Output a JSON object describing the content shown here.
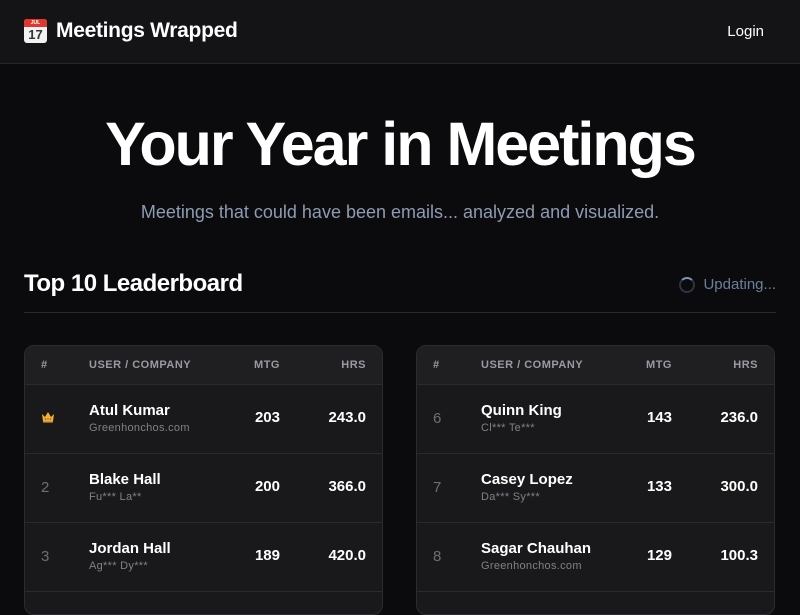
{
  "header": {
    "calendar_icon_month": "JUL",
    "calendar_icon_day": "17",
    "brand_title": "Meetings Wrapped",
    "login_label": "Login"
  },
  "hero": {
    "title": "Your Year in Meetings",
    "subtitle": "Meetings that could have been emails... analyzed and visualized."
  },
  "leaderboard": {
    "title": "Top 10 Leaderboard",
    "status": "Updating...",
    "columns": {
      "rank": "#",
      "user": "USER / COMPANY",
      "mtg": "MTG",
      "hrs": "HRS"
    },
    "left_rows": [
      {
        "rank": "1",
        "rank_icon": "crown-icon",
        "name": "Atul Kumar",
        "company": "Greenhonchos.com",
        "mtg": "203",
        "hrs": "243.0"
      },
      {
        "rank": "2",
        "name": "Blake Hall",
        "company": "Fu*** La**",
        "mtg": "200",
        "hrs": "366.0"
      },
      {
        "rank": "3",
        "name": "Jordan Hall",
        "company": "Ag*** Dy***",
        "mtg": "189",
        "hrs": "420.0"
      }
    ],
    "right_rows": [
      {
        "rank": "6",
        "name": "Quinn King",
        "company": "Cl*** Te***",
        "mtg": "143",
        "hrs": "236.0"
      },
      {
        "rank": "7",
        "name": "Casey Lopez",
        "company": "Da*** Sy***",
        "mtg": "133",
        "hrs": "300.0"
      },
      {
        "rank": "8",
        "name": "Sagar Chauhan",
        "company": "Greenhonchos.com",
        "mtg": "129",
        "hrs": "100.3"
      }
    ]
  },
  "colors": {
    "background": "#0b0b0d",
    "topbar": "#141416",
    "card": "#19191b",
    "subtitle": "#8d9bb3",
    "crown": "#f2b233"
  }
}
